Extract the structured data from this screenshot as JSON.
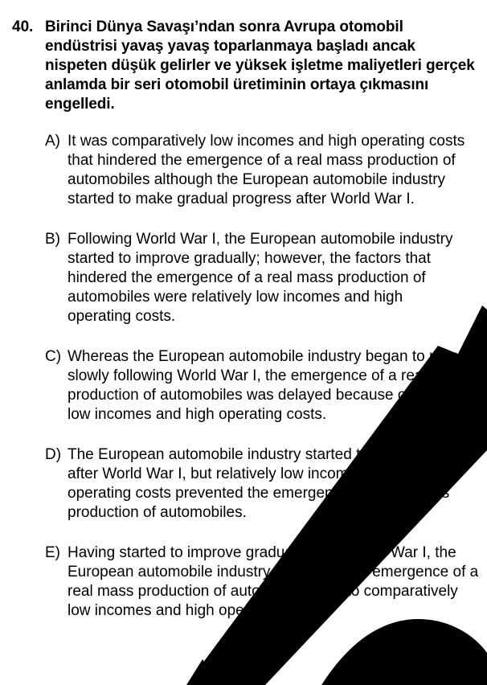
{
  "question": {
    "number": "40.",
    "stem": "Birinci Dünya Savaşı’ndan sonra Avrupa otomobil endüstrisi yavaş yavaş toparlanmaya başladı ancak nispeten düşük gelirler ve yüksek işletme maliyetleri gerçek anlamda bir seri otomobil üretiminin ortaya çıkmasını engelledi.",
    "options": [
      {
        "letter": "A)",
        "text": "It was comparatively low incomes and high operating costs that hindered the emergence of a real mass production of automobiles although the European automobile industry started to make gradual progress after World War I."
      },
      {
        "letter": "B)",
        "text": "Following World War I, the European automobile industry started to improve gradually; however, the factors that hindered the emergence of a real mass production of automobiles were relatively low incomes and high operating costs."
      },
      {
        "letter": "C)",
        "text": "Whereas the European automobile industry began to recover slowly following World War I, the emergence of a real mass production of automobiles was delayed because of relatively low incomes and high operating costs."
      },
      {
        "letter": "D)",
        "text": "The European automobile industry started to recover slowly after World War I, but relatively low incomes and high operating costs prevented the emergence of a real mass production of automobiles."
      },
      {
        "letter": "E)",
        "text": "Having started to improve gradually after World War I, the European automobile industry prevented the emergence of a real mass production of automobiles due to comparatively low incomes and high operating costs."
      }
    ]
  },
  "colors": {
    "text": "#000000",
    "background": "#ffffff",
    "watermark": "#000000"
  }
}
